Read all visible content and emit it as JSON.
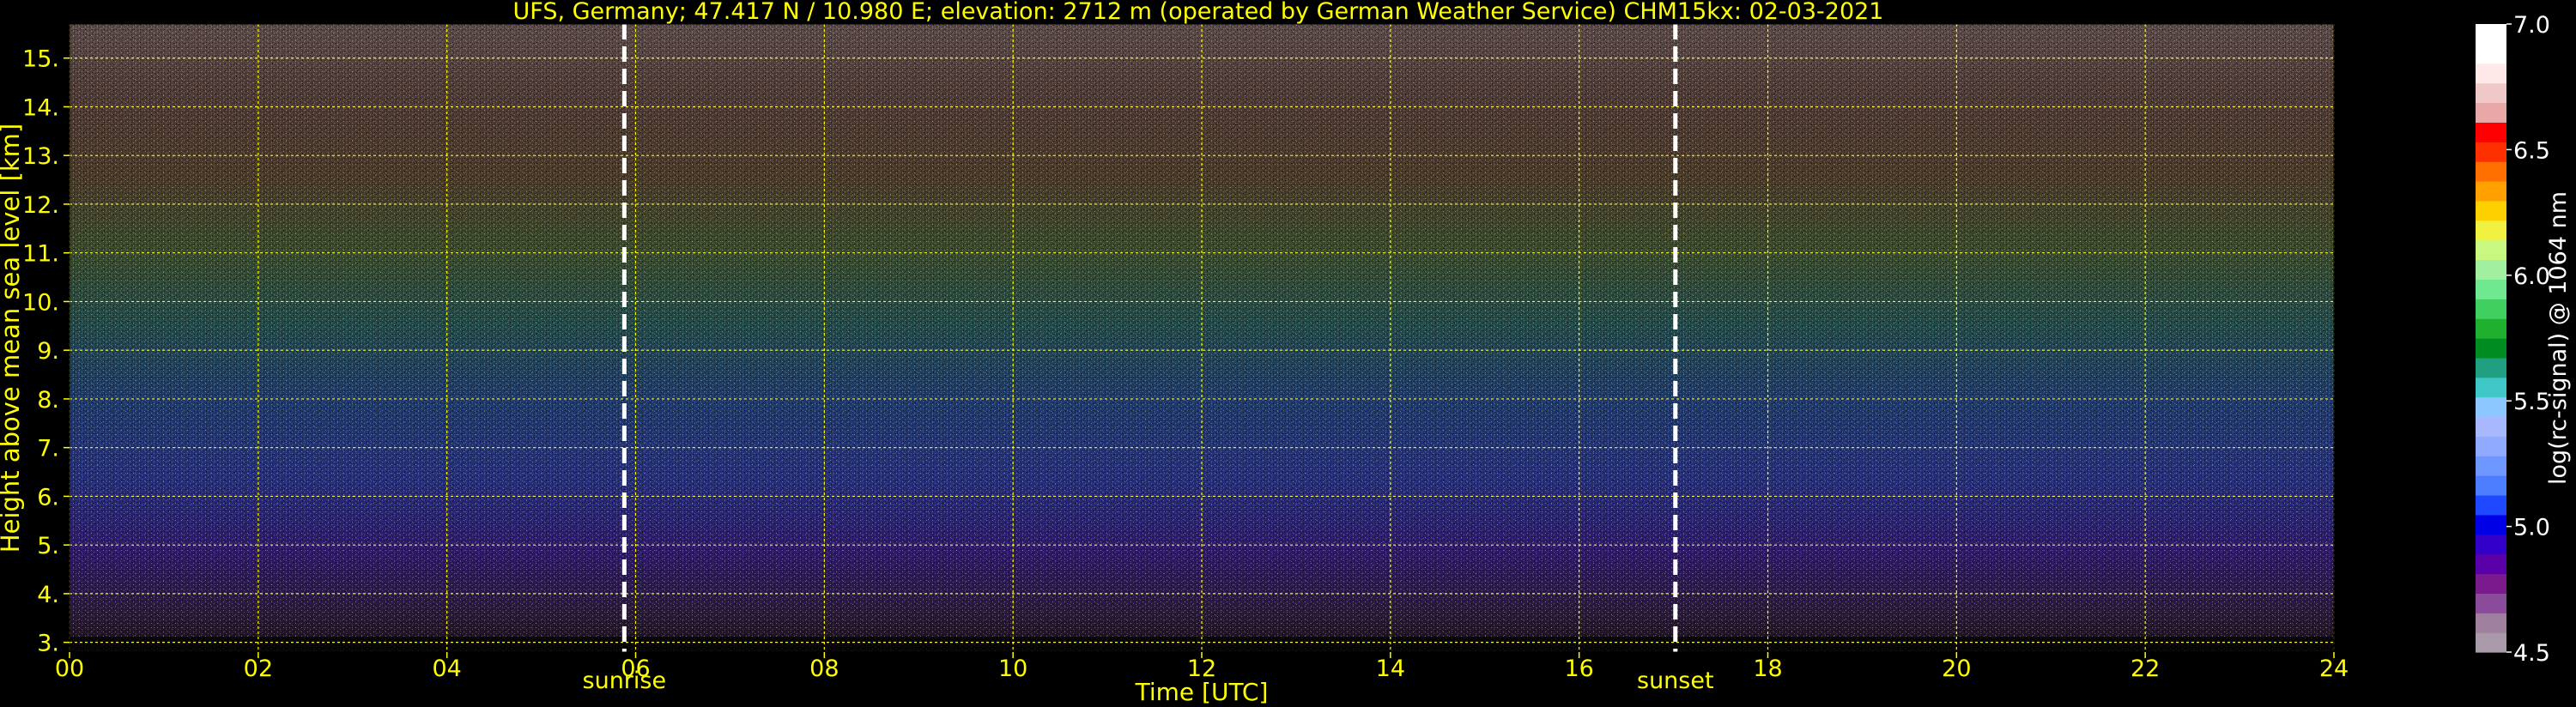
{
  "chart_data": {
    "type": "heatmap",
    "title": "UFS, Germany; 47.417 N / 10.980 E; elevation: 2712 m  (operated by German Weather Service)    CHM15kx: 02-03-2021",
    "xlabel": "Time [UTC]",
    "ylabel": "Height above mean sea level [km]",
    "xlim": [
      0,
      24
    ],
    "ylim": [
      2.8,
      15.7
    ],
    "x_ticks": [
      "00",
      "02",
      "04",
      "06",
      "08",
      "10",
      "12",
      "14",
      "16",
      "18",
      "20",
      "22",
      "24"
    ],
    "y_ticks": [
      "3.",
      "4.",
      "5.",
      "6.",
      "7.",
      "8.",
      "9.",
      "10.",
      "11.",
      "12.",
      "13.",
      "14.",
      "15."
    ],
    "grid": true,
    "markers": [
      {
        "label": "sunrise",
        "time": 5.88
      },
      {
        "label": "sunset",
        "time": 17.02
      }
    ],
    "colorbar": {
      "label": "log(rc-signal) @ 1064 nm",
      "range": [
        4.5,
        7.0
      ],
      "ticks": [
        "4.5",
        "5.0",
        "5.5",
        "6.0",
        "6.5",
        "7.0"
      ],
      "colors": [
        "#a89aa8",
        "#9e7f9e",
        "#8a4c9a",
        "#7a1a8c",
        "#5a00a8",
        "#3200c8",
        "#0000e6",
        "#1e48ff",
        "#4d7dff",
        "#6e96ff",
        "#8faaff",
        "#a8b8ff",
        "#8cc8ff",
        "#40c8c8",
        "#20a080",
        "#008c20",
        "#20b030",
        "#40d060",
        "#70e890",
        "#a0f0a0",
        "#c8f880",
        "#f0f040",
        "#ffd000",
        "#ffa000",
        "#ff7000",
        "#ff3000",
        "#ff0000",
        "#e8a8a8",
        "#f0c8c8",
        "#ffe8e8",
        "#ffffff",
        "#ffffff"
      ]
    }
  }
}
